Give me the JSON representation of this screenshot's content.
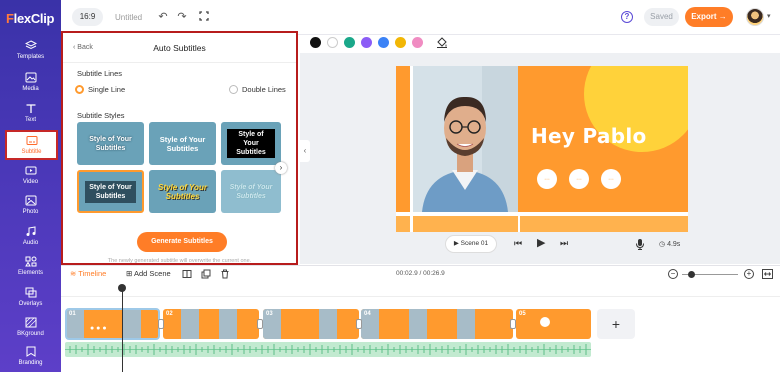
{
  "app": {
    "logo_brand": "F",
    "logo_rest": "lexClip"
  },
  "sidebar": {
    "items": [
      {
        "label": "Templates",
        "icon": "templates-icon"
      },
      {
        "label": "Media",
        "icon": "media-icon"
      },
      {
        "label": "Text",
        "icon": "text-icon"
      },
      {
        "label": "Subtitle",
        "icon": "subtitle-icon",
        "active": true
      },
      {
        "label": "Video",
        "icon": "video-icon"
      },
      {
        "label": "Photo",
        "icon": "photo-icon"
      },
      {
        "label": "Audio",
        "icon": "audio-icon"
      },
      {
        "label": "Elements",
        "icon": "elements-icon"
      },
      {
        "label": "Overlays",
        "icon": "overlays-icon"
      },
      {
        "label": "BKground",
        "icon": "background-icon"
      },
      {
        "label": "Branding",
        "icon": "branding-icon"
      }
    ]
  },
  "topbar": {
    "ratio": "16:9",
    "title": "Untitled",
    "help": "?",
    "saved_label": "Saved",
    "export_label": "Export →",
    "avatar_chevron": "▾"
  },
  "colors": {
    "swatches": [
      "#111111",
      "#ffffff",
      "#1aa88a",
      "#8b5cf6",
      "#3b82f6",
      "#f2b705",
      "#f08cc2"
    ],
    "accent": "#ff7d27",
    "sidebar": "#4a38b8"
  },
  "panel": {
    "back_label": "Back",
    "title": "Auto Subtitles",
    "lines_heading": "Subtitle Lines",
    "single_line": "Single Line",
    "double_lines": "Double Lines",
    "styles_heading": "Subtitle Styles",
    "styles": [
      "Style of Your Subtitles",
      "Style of Your Subtitles",
      "Style of Your Subtitles",
      "Style of Your Subtitles",
      "Style of Your Subtitles",
      "Style of Your Subtitles"
    ],
    "generate_label": "Generate Subtitles",
    "note": "The newly generated subtitle will overwrite the current one."
  },
  "preview": {
    "headline": "Hey Pablo",
    "scene_label": "Scene 01",
    "duration": "4.9s"
  },
  "timeline": {
    "tab_label": "Timeline",
    "add_scene_label": "Add Scene",
    "time_display": "00:02.9 / 00:26.9",
    "clips": [
      {
        "num": "01"
      },
      {
        "num": "02"
      },
      {
        "num": "03"
      },
      {
        "num": "04"
      },
      {
        "num": "05"
      }
    ],
    "add_label": "+"
  }
}
